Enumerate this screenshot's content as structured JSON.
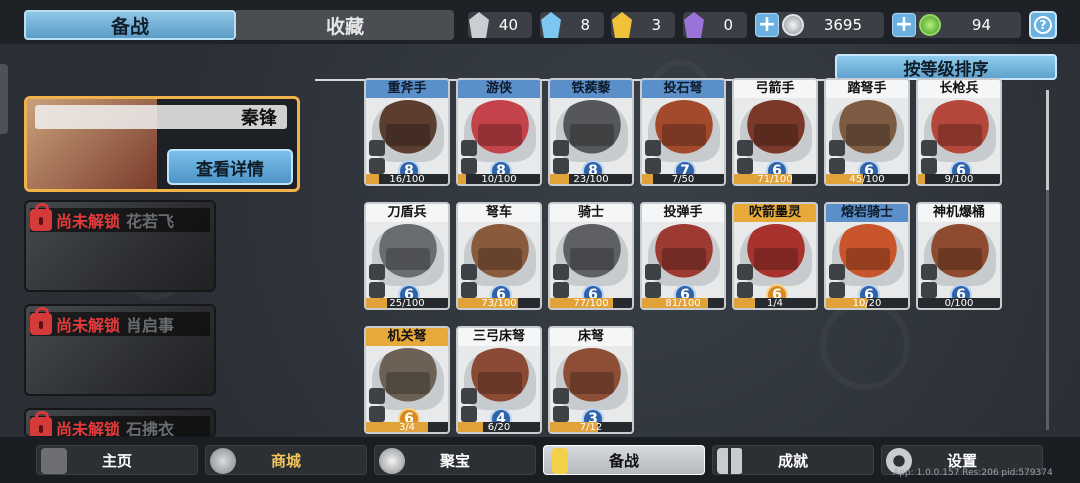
{
  "tabs": {
    "active": "备战",
    "other": "收藏"
  },
  "resources": [
    {
      "icon": "silver-shard-icon",
      "value": "40",
      "color": "#c9ced3"
    },
    {
      "icon": "blue-crystal-icon",
      "value": "8",
      "color": "#7cc6f0"
    },
    {
      "icon": "gold-shield-icon",
      "value": "3",
      "color": "#f0c23a"
    },
    {
      "icon": "purple-shield-icon",
      "value": "0",
      "color": "#9b72d8"
    }
  ],
  "currency": {
    "silver": {
      "icon": "silver-coin-icon",
      "value": "3695"
    },
    "green": {
      "icon": "green-gem-icon",
      "value": "94"
    }
  },
  "help_icon": "?",
  "hero": {
    "name": "秦锋",
    "detail_button": "查看详情"
  },
  "locked_heroes": [
    {
      "status": "尚未解锁",
      "name": "花若飞"
    },
    {
      "status": "尚未解锁",
      "name": "肖启事"
    },
    {
      "status": "尚未解锁",
      "name": "石拂衣"
    }
  ],
  "sort_button": "按等级排序",
  "units": [
    {
      "name": "重斧手",
      "level": "8",
      "progress": "16/100",
      "frac": 0.16,
      "rarity": "blue",
      "art": "#5b3e2f"
    },
    {
      "name": "游侠",
      "level": "8",
      "progress": "10/100",
      "frac": 0.1,
      "rarity": "blue",
      "art": "#c4424a"
    },
    {
      "name": "铁蒺藜",
      "level": "8",
      "progress": "23/100",
      "frac": 0.23,
      "rarity": "blue",
      "art": "#55575a"
    },
    {
      "name": "投石弩",
      "level": "7",
      "progress": "7/50",
      "frac": 0.14,
      "rarity": "blue",
      "art": "#a34a2c"
    },
    {
      "name": "弓箭手",
      "level": "6",
      "progress": "71/100",
      "frac": 0.71,
      "rarity": "grey",
      "art": "#7a3828"
    },
    {
      "name": "踏弩手",
      "level": "6",
      "progress": "45/100",
      "frac": 0.45,
      "rarity": "grey",
      "art": "#7d5a42"
    },
    {
      "name": "长枪兵",
      "level": "6",
      "progress": "9/100",
      "frac": 0.09,
      "rarity": "grey",
      "art": "#b5473a"
    },
    {
      "name": "刀盾兵",
      "level": "6",
      "progress": "25/100",
      "frac": 0.25,
      "rarity": "grey",
      "art": "#6a6d70"
    },
    {
      "name": "弩车",
      "level": "6",
      "progress": "73/100",
      "frac": 0.73,
      "rarity": "grey",
      "art": "#8a5a3c"
    },
    {
      "name": "骑士",
      "level": "6",
      "progress": "77/100",
      "frac": 0.77,
      "rarity": "grey",
      "art": "#5e6064"
    },
    {
      "name": "投弹手",
      "level": "6",
      "progress": "81/100",
      "frac": 0.81,
      "rarity": "grey",
      "art": "#9c3a32"
    },
    {
      "name": "吹箭墨灵",
      "level": "6",
      "progress": "1/4",
      "frac": 0.25,
      "rarity": "gold",
      "art": "#a8332c"
    },
    {
      "name": "熔岩骑士",
      "level": "6",
      "progress": "10/20",
      "frac": 0.5,
      "rarity": "blue",
      "art": "#c8552b"
    },
    {
      "name": "神机爆桶",
      "level": "6",
      "progress": "0/100",
      "frac": 0.0,
      "rarity": "grey",
      "art": "#8f4b30"
    },
    {
      "name": "机关弩",
      "level": "6",
      "progress": "3/4",
      "frac": 0.75,
      "rarity": "gold",
      "art": "#6d6155"
    },
    {
      "name": "三弓床弩",
      "level": "4",
      "progress": "6/20",
      "frac": 0.3,
      "rarity": "grey",
      "art": "#8b4a34"
    },
    {
      "name": "床弩",
      "level": "3",
      "progress": "7/12",
      "frac": 0.58,
      "rarity": "grey",
      "art": "#8e4e36"
    }
  ],
  "nav": [
    {
      "label": "主页",
      "icon": "home-icon",
      "active": false
    },
    {
      "label": "商城",
      "icon": "shop-coins-icon",
      "active": false
    },
    {
      "label": "聚宝",
      "icon": "treasure-bowl-icon",
      "active": false
    },
    {
      "label": "备战",
      "icon": "prep-card-icon",
      "active": true
    },
    {
      "label": "成就",
      "icon": "achievement-grid-icon",
      "active": false
    },
    {
      "label": "设置",
      "icon": "gear-icon",
      "active": false
    }
  ],
  "version": "App: 1.0.0.157 Res:206 pid:579374"
}
